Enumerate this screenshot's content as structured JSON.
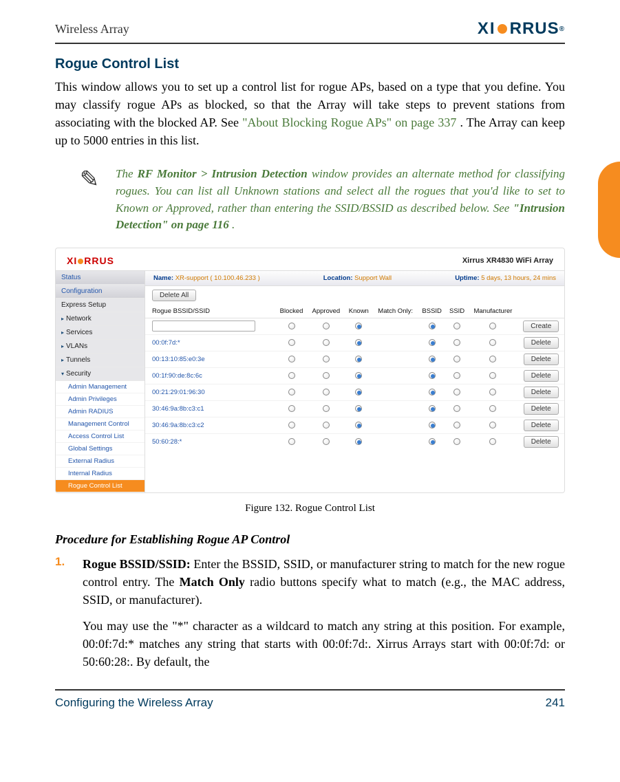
{
  "header": {
    "title": "Wireless Array",
    "brand_first": "XI",
    "brand_rest": "RRUS",
    "brand_tm": "®"
  },
  "section": {
    "heading": "Rogue Control List",
    "para_start": "This window allows you to set up a control list for rogue APs, based on a type that you define. You may classify rogue APs as blocked, so that the Array will take steps to prevent stations from associating with the blocked AP. See ",
    "link1": "\"About Blocking Rogue APs\" on page 337",
    "para_end": ". The Array can keep up to 5000 entries in this list."
  },
  "note": {
    "icon_glyph": "✎",
    "text_1": "The ",
    "bold_1": "RF Monitor > Intrusion Detection",
    "text_2": " window provides an alternate method for classifying rogues. You can list all Unknown stations and select all the rogues that you'd like to set to Known or Approved, rather than entering the SSID/BSSID as described below. See ",
    "crossref": "\"Intrusion Detection\" on page 116",
    "text_3": "."
  },
  "shot": {
    "logo_first": "XI",
    "logo_rest": "RRUS",
    "model": "Xirrus XR4830 WiFi Array",
    "info": {
      "name_lbl": "Name:",
      "name_val": "XR-support   ( 10.100.46.233 )",
      "loc_lbl": "Location:",
      "loc_val": "Support Wall",
      "uptime_lbl": "Uptime:",
      "uptime_val": "5 days, 13 hours, 24 mins"
    },
    "nav": {
      "top": [
        "Status",
        "Configuration"
      ],
      "items": [
        "Express Setup",
        "Network",
        "Services",
        "VLANs",
        "Tunnels",
        "Security"
      ],
      "subs": [
        "Admin Management",
        "Admin Privileges",
        "Admin RADIUS",
        "Management Control",
        "Access Control List",
        "Global Settings",
        "External Radius",
        "Internal Radius",
        "Rogue Control List"
      ]
    },
    "toolbar": {
      "delete_all": "Delete All"
    },
    "table": {
      "headers": [
        "Rogue BSSID/SSID",
        "Blocked",
        "Approved",
        "Known",
        "Match Only:",
        "BSSID",
        "SSID",
        "Manufacturer",
        ""
      ],
      "create_btn": "Create",
      "delete_btn": "Delete",
      "rows": [
        {
          "bssid": "00:0f:7d:*",
          "sel_a": 2,
          "sel_b": 0
        },
        {
          "bssid": "00:13:10:85:e0:3e",
          "sel_a": 2,
          "sel_b": 0
        },
        {
          "bssid": "00:1f:90:de:8c:6c",
          "sel_a": 2,
          "sel_b": 0
        },
        {
          "bssid": "00:21:29:01:96:30",
          "sel_a": 2,
          "sel_b": 0
        },
        {
          "bssid": "30:46:9a:8b:c3:c1",
          "sel_a": 2,
          "sel_b": 0
        },
        {
          "bssid": "30:46:9a:8b:c3:c2",
          "sel_a": 2,
          "sel_b": 0
        },
        {
          "bssid": "50:60:28:*",
          "sel_a": 2,
          "sel_b": 0
        }
      ]
    }
  },
  "figure_caption": "Figure 132. Rogue Control List",
  "proc": {
    "title": "Procedure for Establishing Rogue AP Control",
    "items": [
      {
        "num": "1.",
        "strong": "Rogue BSSID/SSID:",
        "p1_rest": " Enter the BSSID, SSID, or manufacturer string to match for the new rogue control entry. The ",
        "p1_bold2": "Match Only",
        "p1_tail": " radio buttons specify what to match (e.g., the MAC address, SSID, or manufacturer).",
        "p2": "You may use the \"*\" character as a wildcard to match any string at this position. For example, 00:0f:7d:* matches any string that starts with 00:0f:7d:. Xirrus Arrays start with 00:0f:7d: or 50:60:28:. By default, the"
      }
    ]
  },
  "footer": {
    "left": "Configuring the Wireless Array",
    "right": "241"
  }
}
